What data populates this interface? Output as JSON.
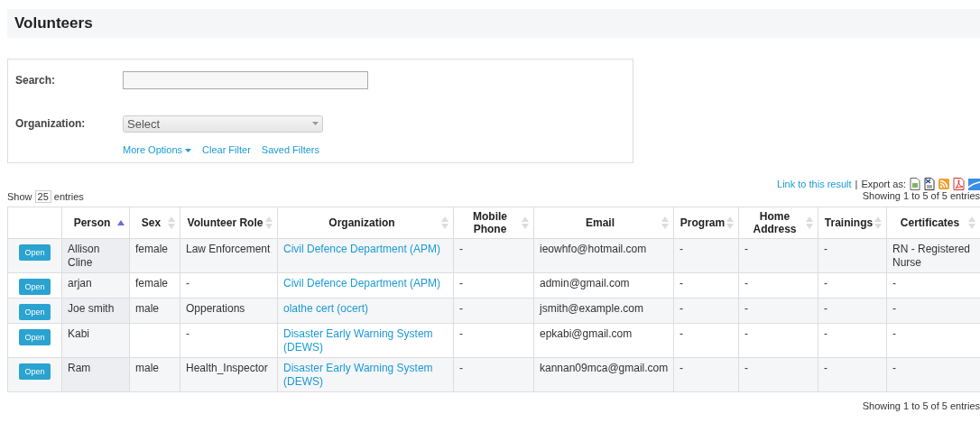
{
  "title": "Volunteers",
  "filter": {
    "fields": [
      {
        "label": "Search:",
        "kind": "text"
      },
      {
        "label": "Organization:",
        "kind": "select",
        "value": "Select"
      }
    ],
    "links": [
      {
        "label": "More Options",
        "caret": true
      },
      {
        "label": "Clear Filter",
        "caret": false
      },
      {
        "label": "Saved Filters",
        "caret": false
      }
    ]
  },
  "link_to_result": "Link to this result",
  "separator": "|",
  "export_label": "Export as:",
  "length": {
    "before": "Show",
    "value": "25",
    "after": "entries"
  },
  "info_top": "Showing 1 to 5 of 5 entries",
  "table": {
    "columns": [
      {
        "sortable": false
      },
      {
        "label": "Person",
        "sortable": true,
        "sorted": true
      },
      {
        "label": "Sex",
        "sortable": true,
        "sorted": false
      },
      {
        "label": "Volunteer Role",
        "sortable": true,
        "sorted": false
      },
      {
        "label": "Organization",
        "sortable": true,
        "sorted": false
      },
      {
        "label": "Mobile Phone",
        "sortable": true,
        "sorted": false
      },
      {
        "label": "Email",
        "sortable": true,
        "sorted": false
      },
      {
        "label": "Program",
        "sortable": true,
        "sorted": false
      },
      {
        "label": "Home Address",
        "sortable": true,
        "sorted": false
      },
      {
        "label": "Trainings",
        "sortable": true,
        "sorted": false
      },
      {
        "label": "Certificates",
        "sortable": true,
        "sorted": false
      }
    ],
    "rows": [
      {
        "cells": [
          {
            "kind": "button",
            "text": "Open"
          },
          {
            "kind": "text",
            "text": "Allison Cline"
          },
          {
            "kind": "text",
            "text": "female"
          },
          {
            "kind": "text",
            "text": "Law Enforcement"
          },
          {
            "kind": "link",
            "text": "Civil Defence Department (APM)"
          },
          {
            "kind": "text",
            "text": "-"
          },
          {
            "kind": "text",
            "text": "ieowhfo@hotmail.com"
          },
          {
            "kind": "text",
            "text": "-"
          },
          {
            "kind": "text",
            "text": "-"
          },
          {
            "kind": "text",
            "text": "-"
          },
          {
            "kind": "text",
            "text": "RN - Registered Nurse"
          }
        ]
      },
      {
        "cells": [
          {
            "kind": "button",
            "text": "Open"
          },
          {
            "kind": "text",
            "text": "arjan"
          },
          {
            "kind": "text",
            "text": "female"
          },
          {
            "kind": "text",
            "text": "-"
          },
          {
            "kind": "link",
            "text": "Civil Defence Department (APM)"
          },
          {
            "kind": "text",
            "text": "-"
          },
          {
            "kind": "text",
            "text": "admin@gmail.com"
          },
          {
            "kind": "text",
            "text": "-"
          },
          {
            "kind": "text",
            "text": "-"
          },
          {
            "kind": "text",
            "text": "-"
          },
          {
            "kind": "text",
            "text": "-"
          }
        ]
      },
      {
        "cells": [
          {
            "kind": "button",
            "text": "Open"
          },
          {
            "kind": "text",
            "text": "Joe smith"
          },
          {
            "kind": "text",
            "text": "male"
          },
          {
            "kind": "text",
            "text": "Opperations"
          },
          {
            "kind": "link",
            "text": "olathe cert (ocert)"
          },
          {
            "kind": "text",
            "text": "-"
          },
          {
            "kind": "text",
            "text": "jsmith@example.com"
          },
          {
            "kind": "text",
            "text": "-"
          },
          {
            "kind": "text",
            "text": "-"
          },
          {
            "kind": "text",
            "text": "-"
          },
          {
            "kind": "text",
            "text": "-"
          }
        ]
      },
      {
        "cells": [
          {
            "kind": "button",
            "text": "Open"
          },
          {
            "kind": "text",
            "text": "Kabi"
          },
          {
            "kind": "empty"
          },
          {
            "kind": "text",
            "text": "-"
          },
          {
            "kind": "link",
            "text": "Disaster Early Warning System (DEWS)"
          },
          {
            "kind": "text",
            "text": "-"
          },
          {
            "kind": "text",
            "text": "epkabi@gmail.com"
          },
          {
            "kind": "text",
            "text": "-"
          },
          {
            "kind": "text",
            "text": "-"
          },
          {
            "kind": "text",
            "text": "-"
          },
          {
            "kind": "text",
            "text": "-"
          }
        ]
      },
      {
        "cells": [
          {
            "kind": "button",
            "text": "Open"
          },
          {
            "kind": "text",
            "text": "Ram"
          },
          {
            "kind": "text",
            "text": "male"
          },
          {
            "kind": "text",
            "text": "Health_Inspector"
          },
          {
            "kind": "link",
            "text": "Disaster Early Warning System (DEWS)"
          },
          {
            "kind": "text",
            "text": "-"
          },
          {
            "kind": "text",
            "text": "kannan09mca@gmail.com"
          },
          {
            "kind": "text",
            "text": "-"
          },
          {
            "kind": "text",
            "text": "-"
          },
          {
            "kind": "text",
            "text": "-"
          },
          {
            "kind": "text",
            "text": "-"
          }
        ]
      }
    ]
  },
  "info_bottom": "Showing 1 to 5 of 5 entries"
}
